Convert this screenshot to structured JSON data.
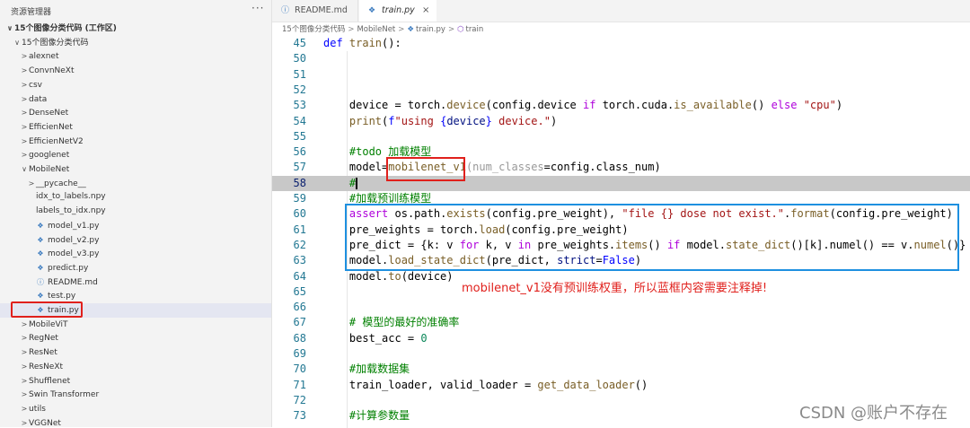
{
  "sidebar": {
    "title": "资源管理器",
    "more": "···",
    "items": [
      {
        "chev": "∨",
        "label": "15个图像分类代码 (工作区)",
        "indent": 0,
        "icon": "",
        "bold": true
      },
      {
        "chev": "∨",
        "label": "15个图像分类代码",
        "indent": 1,
        "icon": ""
      },
      {
        "chev": ">",
        "label": "alexnet",
        "indent": 2,
        "icon": ""
      },
      {
        "chev": ">",
        "label": "ConvnNeXt",
        "indent": 2,
        "icon": ""
      },
      {
        "chev": ">",
        "label": "csv",
        "indent": 2,
        "icon": ""
      },
      {
        "chev": ">",
        "label": "data",
        "indent": 2,
        "icon": ""
      },
      {
        "chev": ">",
        "label": "DenseNet",
        "indent": 2,
        "icon": ""
      },
      {
        "chev": ">",
        "label": "EfficienNet",
        "indent": 2,
        "icon": ""
      },
      {
        "chev": ">",
        "label": "EfficienNetV2",
        "indent": 2,
        "icon": ""
      },
      {
        "chev": ">",
        "label": "googlenet",
        "indent": 2,
        "icon": ""
      },
      {
        "chev": "∨",
        "label": "MobileNet",
        "indent": 2,
        "icon": ""
      },
      {
        "chev": ">",
        "label": "__pycache__",
        "indent": 3,
        "icon": ""
      },
      {
        "chev": "",
        "label": "idx_to_labels.npy",
        "indent": 3,
        "icon": ""
      },
      {
        "chev": "",
        "label": "labels_to_idx.npy",
        "indent": 3,
        "icon": ""
      },
      {
        "chev": "",
        "label": "model_v1.py",
        "indent": 3,
        "icon": "py"
      },
      {
        "chev": "",
        "label": "model_v2.py",
        "indent": 3,
        "icon": "py"
      },
      {
        "chev": "",
        "label": "model_v3.py",
        "indent": 3,
        "icon": "py"
      },
      {
        "chev": "",
        "label": "predict.py",
        "indent": 3,
        "icon": "py"
      },
      {
        "chev": "",
        "label": "README.md",
        "indent": 3,
        "icon": "md"
      },
      {
        "chev": "",
        "label": "test.py",
        "indent": 3,
        "icon": "py"
      },
      {
        "chev": "",
        "label": "train.py",
        "indent": 3,
        "icon": "py",
        "active": true
      },
      {
        "chev": ">",
        "label": "MobileViT",
        "indent": 2,
        "icon": ""
      },
      {
        "chev": ">",
        "label": "RegNet",
        "indent": 2,
        "icon": ""
      },
      {
        "chev": ">",
        "label": "ResNet",
        "indent": 2,
        "icon": ""
      },
      {
        "chev": ">",
        "label": "ResNeXt",
        "indent": 2,
        "icon": ""
      },
      {
        "chev": ">",
        "label": "Shufflenet",
        "indent": 2,
        "icon": ""
      },
      {
        "chev": ">",
        "label": "Swin Transformer",
        "indent": 2,
        "icon": ""
      },
      {
        "chev": ">",
        "label": "utils",
        "indent": 2,
        "icon": ""
      },
      {
        "chev": ">",
        "label": "VGGNet",
        "indent": 2,
        "icon": ""
      }
    ]
  },
  "tabs": [
    {
      "label": "README.md",
      "icon": "ⓘ"
    },
    {
      "label": "train.py",
      "icon": "❖",
      "close": "×"
    }
  ],
  "breadcrumb": {
    "parts": [
      "15个图像分类代码",
      "MobileNet",
      "train.py",
      "train"
    ],
    "sep": ">"
  },
  "editor": {
    "lines": [
      {
        "n": "45",
        "tokens": [
          [
            "kw",
            "def "
          ],
          [
            "fn",
            "train"
          ],
          [
            "",
            "():"
          ]
        ]
      },
      {
        "n": "50",
        "tokens": []
      },
      {
        "n": "51",
        "tokens": []
      },
      {
        "n": "52",
        "tokens": []
      },
      {
        "n": "53",
        "tokens": [
          [
            "",
            "    device = torch."
          ],
          [
            "fn",
            "device"
          ],
          [
            "",
            "(config.device "
          ],
          [
            "key",
            "if"
          ],
          [
            "",
            " torch.cuda."
          ],
          [
            "fn",
            "is_available"
          ],
          [
            "",
            "() "
          ],
          [
            "key",
            "else"
          ],
          [
            "",
            " "
          ],
          [
            "str",
            "\"cpu\""
          ],
          [
            "",
            ")"
          ]
        ]
      },
      {
        "n": "54",
        "tokens": [
          [
            "",
            "    "
          ],
          [
            "fn",
            "print"
          ],
          [
            "",
            "("
          ],
          [
            "kw",
            "f"
          ],
          [
            "str",
            "\"using "
          ],
          [
            "kw",
            "{"
          ],
          [
            "var",
            "device"
          ],
          [
            "kw",
            "}"
          ],
          [
            "str",
            " device.\""
          ],
          [
            "",
            ")"
          ]
        ]
      },
      {
        "n": "55",
        "tokens": []
      },
      {
        "n": "56",
        "tokens": [
          [
            "",
            "    "
          ],
          [
            "cm",
            "#todo 加载模型"
          ]
        ]
      },
      {
        "n": "57",
        "tokens": [
          [
            "",
            "    model="
          ],
          [
            "fn",
            "mobilenet_v1"
          ],
          [
            "dim",
            "(num_classes"
          ],
          [
            "",
            "=config.class_num)"
          ]
        ]
      },
      {
        "n": "58",
        "tokens": [
          [
            "",
            "    "
          ],
          [
            "cm",
            "#"
          ],
          [
            "cursor",
            ""
          ]
        ],
        "highlight": true
      },
      {
        "n": "59",
        "tokens": [
          [
            "",
            "    "
          ],
          [
            "cm",
            "#加载预训练模型"
          ]
        ]
      },
      {
        "n": "60",
        "tokens": [
          [
            "",
            "    "
          ],
          [
            "key",
            "assert"
          ],
          [
            "",
            " os.path."
          ],
          [
            "fn",
            "exists"
          ],
          [
            "",
            "(config.pre_weight), "
          ],
          [
            "str",
            "\"file {} dose not exist.\""
          ],
          [
            "",
            "."
          ],
          [
            "fn",
            "format"
          ],
          [
            "",
            "(config.pre_weight)"
          ]
        ]
      },
      {
        "n": "61",
        "tokens": [
          [
            "",
            "    pre_weights = torch."
          ],
          [
            "fn",
            "load"
          ],
          [
            "",
            "(config.pre_weight)"
          ]
        ]
      },
      {
        "n": "62",
        "tokens": [
          [
            "",
            "    pre_dict = {k: v "
          ],
          [
            "key",
            "for"
          ],
          [
            "",
            " k, v "
          ],
          [
            "key",
            "in"
          ],
          [
            "",
            " pre_weights."
          ],
          [
            "fn",
            "items"
          ],
          [
            "",
            "() "
          ],
          [
            "key",
            "if"
          ],
          [
            "",
            " model."
          ],
          [
            "fn",
            "state_dict"
          ],
          [
            "",
            "()[k].numel() == v."
          ],
          [
            "fn",
            "numel"
          ],
          [
            "",
            "()}"
          ]
        ]
      },
      {
        "n": "63",
        "tokens": [
          [
            "",
            "    model."
          ],
          [
            "fn",
            "load_state_dict"
          ],
          [
            "",
            "(pre_dict, "
          ],
          [
            "var",
            "strict"
          ],
          [
            "",
            "="
          ],
          [
            "kw",
            "False"
          ],
          [
            "",
            ")"
          ]
        ]
      },
      {
        "n": "64",
        "tokens": [
          [
            "",
            "    model."
          ],
          [
            "fn",
            "to"
          ],
          [
            "",
            "(device)"
          ]
        ]
      },
      {
        "n": "65",
        "tokens": []
      },
      {
        "n": "66",
        "tokens": []
      },
      {
        "n": "67",
        "tokens": [
          [
            "",
            "    "
          ],
          [
            "cm",
            "# 模型的最好的准确率"
          ]
        ]
      },
      {
        "n": "68",
        "tokens": [
          [
            "",
            "    best_acc = "
          ],
          [
            "num",
            "0"
          ]
        ]
      },
      {
        "n": "69",
        "tokens": []
      },
      {
        "n": "70",
        "tokens": [
          [
            "",
            "    "
          ],
          [
            "cm",
            "#加载数据集"
          ]
        ]
      },
      {
        "n": "71",
        "tokens": [
          [
            "",
            "    train_loader, valid_loader = "
          ],
          [
            "fn",
            "get_data_loader"
          ],
          [
            "",
            "()"
          ]
        ]
      },
      {
        "n": "72",
        "tokens": []
      },
      {
        "n": "73",
        "tokens": [
          [
            "",
            "    "
          ],
          [
            "cm",
            "#计算参数量"
          ]
        ]
      }
    ]
  },
  "annotation": "mobilenet_v1没有预训练权重，所以蓝框内容需要注释掉!",
  "watermark": "CSDN @账户不存在",
  "colors": {
    "annotation_red": "#e0201c",
    "box_blue": "#1e90e0",
    "line_highlight": "#c8c8c8"
  }
}
